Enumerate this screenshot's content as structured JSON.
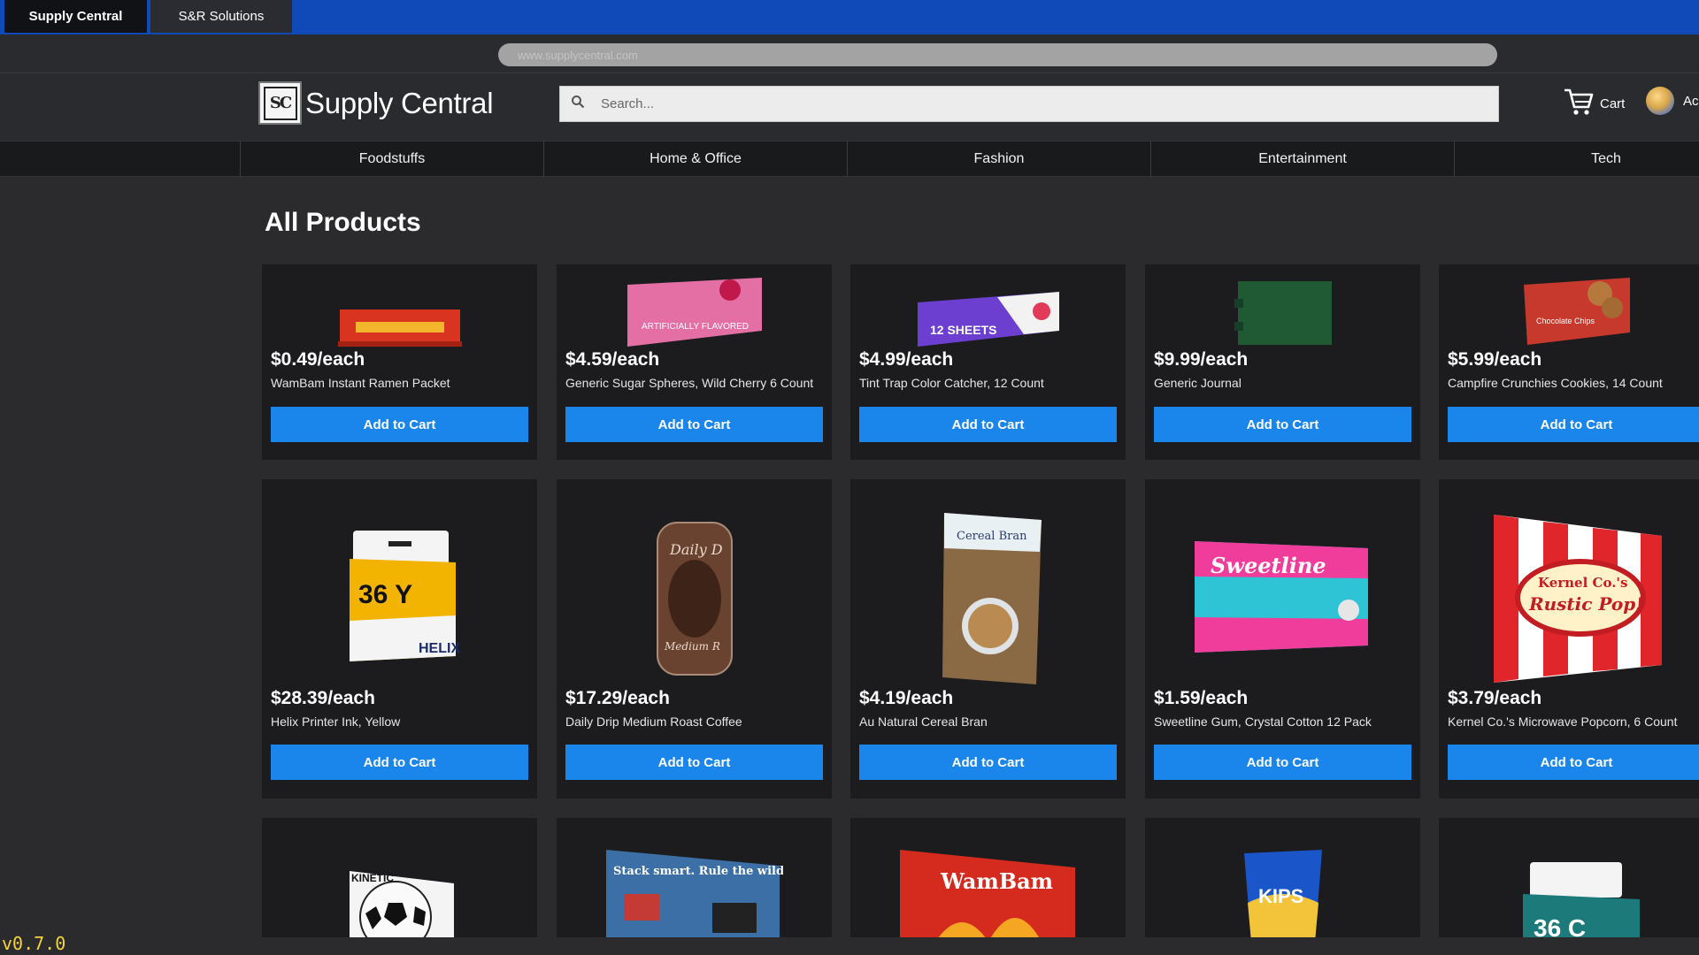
{
  "browser": {
    "tabs": [
      {
        "label": "Supply Central",
        "active": true
      },
      {
        "label": "S&R Solutions",
        "active": false
      }
    ],
    "url": "www.supplycentral.com"
  },
  "header": {
    "logo_initials": "SC",
    "brand": "Supply Central",
    "search_placeholder": "Search...",
    "cart_label": "Cart",
    "account_label": "Ac"
  },
  "nav": {
    "categories": [
      "Foodstuffs",
      "Home & Office",
      "Fashion",
      "Entertainment",
      "Tech"
    ]
  },
  "main": {
    "title": "All Products",
    "add_to_cart_label": "Add to Cart",
    "products": [
      {
        "price": "$0.49/each",
        "name": "WamBam Instant Ramen Packet",
        "icon": "ramen-packet-image",
        "color": "#d9341f"
      },
      {
        "price": "$4.59/each",
        "name": "Generic Sugar Spheres, Wild Cherry 6 Count",
        "icon": "candy-box-image",
        "color": "#e36fa5"
      },
      {
        "price": "$4.99/each",
        "name": "Tint Trap Color Catcher, 12 Count",
        "icon": "color-catcher-box-image",
        "color": "#6c3fd1"
      },
      {
        "price": "$9.99/each",
        "name": "Generic Journal",
        "icon": "journal-image",
        "color": "#1f5a34"
      },
      {
        "price": "$5.99/each",
        "name": "Campfire Crunchies Cookies, 14 Count",
        "icon": "cookie-box-image",
        "color": "#c7392c"
      },
      {
        "price": "$28.39/each",
        "name": "Helix Printer Ink, Yellow",
        "icon": "printer-ink-image",
        "color": "#f2b400"
      },
      {
        "price": "$17.29/each",
        "name": "Daily Drip Medium Roast Coffee",
        "icon": "coffee-jar-image",
        "color": "#6a4330"
      },
      {
        "price": "$4.19/each",
        "name": "Au Natural Cereal Bran",
        "icon": "cereal-box-image",
        "color": "#8a6a45"
      },
      {
        "price": "$1.59/each",
        "name": "Sweetline Gum, Crystal Cotton 12 Pack",
        "icon": "gum-pack-image",
        "color": "#2ec4d6"
      },
      {
        "price": "$3.79/each",
        "name": "Kernel Co.'s Microwave Popcorn, 6 Count",
        "icon": "popcorn-box-image",
        "color": "#e0262a"
      }
    ],
    "partial_products": [
      {
        "icon": "soccer-ball-image",
        "label": "KINETIC"
      },
      {
        "icon": "board-game-box-image",
        "label": "Stack smart. Rule the wild."
      },
      {
        "icon": "ramen-box-image",
        "label": "WamBam"
      },
      {
        "icon": "chips-bag-image",
        "label": "KIPS"
      },
      {
        "icon": "printer-ink-cyan-image",
        "label": "36 C"
      }
    ]
  },
  "footer": {
    "version": "v0.7.0"
  },
  "colors": {
    "tabbar": "#1049b8",
    "accent_button": "#1a86ec",
    "background": "#2b2b2d",
    "card": "#1c1c1f",
    "version_text": "#f4d43a"
  }
}
